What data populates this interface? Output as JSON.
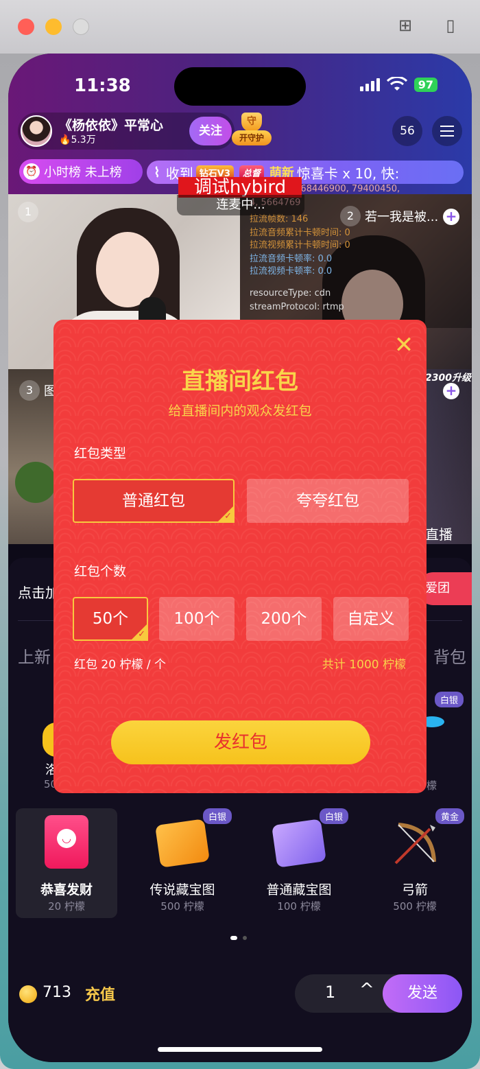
{
  "status": {
    "time": "11:38",
    "battery": "97"
  },
  "header": {
    "host_name": "《杨依依》平常心",
    "heat": "5.3万",
    "follow_label": "关注",
    "guard_icon_text": "守",
    "guard_label": "开守护",
    "viewer_count": "56"
  },
  "rank": {
    "label": "小时榜 未上榜"
  },
  "marquee": {
    "prefix": "收到",
    "diamond_tag": "钻石V3",
    "boss_tag": "总督",
    "cute_tag": "萌新",
    "text": "惊喜卡 x 10, 快:"
  },
  "video": {
    "debug_title": "调试hybird",
    "connect_label": "连麦中...",
    "debug_lines": [
      "98010485, 68446900, 79400450,",
      "4, 5664769",
      "拉流帧数: 146",
      "拉流音频累计卡顿时间: 0",
      "拉流视频累计卡顿时间: 0",
      "拉流音频卡顿率: 0.0",
      "拉流视频卡顿率: 0.0",
      "resourceType: cdn",
      "streamProtocol: rtmp"
    ],
    "seats": [
      {
        "num": "1",
        "name": ""
      },
      {
        "num": "2",
        "name": "若一我是被..."
      },
      {
        "num": "3",
        "name": "图"
      },
      {
        "num": "",
        "name": ""
      }
    ],
    "upgrade_tag": "2300升级",
    "live_tag": "直播"
  },
  "gift_panel": {
    "hint": "点击加",
    "fan_button": "爱团",
    "tab_left": "上新",
    "tab_right": "背包",
    "gifts": [
      {
        "name": "恭喜发财",
        "price": "20 柠檬",
        "tier": ""
      },
      {
        "name": "传说藏宝图",
        "price": "500 柠檬",
        "tier": "白银"
      },
      {
        "name": "普通藏宝图",
        "price": "100 柠檬",
        "tier": "白银"
      },
      {
        "name": "弓箭",
        "price": "500 柠檬",
        "tier": "黄金"
      }
    ],
    "hidden_row": {
      "name_fragment": "洛",
      "price_fragment": "50",
      "right_price_fragment": "檬",
      "right_tier": "白银"
    },
    "balance": "713",
    "recharge_label": "充值",
    "quantity": "1",
    "send_label": "发送"
  },
  "modal": {
    "title": "直播间红包",
    "subtitle": "给直播间内的观众发红包",
    "type_label": "红包类型",
    "types": [
      "普通红包",
      "夸夸红包"
    ],
    "selected_type": "普通红包",
    "count_label": "红包个数",
    "counts": [
      "50个",
      "100个",
      "200个",
      "自定义"
    ],
    "selected_count": "50个",
    "per_packet": "红包 20 柠檬 / 个",
    "total": "共计 1000 柠檬",
    "submit_label": "发红包"
  }
}
